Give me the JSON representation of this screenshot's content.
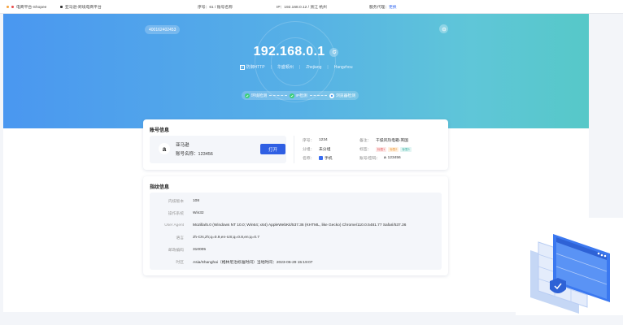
{
  "topbar": {
    "tab1": "电商平台-Shopee",
    "tab2": "亚马逊-跨境电商平台",
    "seq": "序号：61 / 账号名称",
    "ip": "IP：192.168.0.12 / 浙江 杭州",
    "proxy_label": "服务代理：",
    "proxy_link": "更换"
  },
  "hero": {
    "badge": "400162402453",
    "ip": "192.168.0.1",
    "protocol": "防御HTTP",
    "region": "华盛顿州",
    "province": "Zhejiang",
    "city": "Hangzhou",
    "steps": [
      "环境检测",
      "IP检测",
      "浏览器检测"
    ]
  },
  "account": {
    "title": "账号信息",
    "platform": "亚马逊",
    "account_label": "账号名称：",
    "account_value": "123456",
    "open_button": "打开",
    "seq_key": "序号：",
    "seq_value": "1234",
    "group_key": "分组：",
    "group_value": "未分组",
    "cat_key": "名称：",
    "cat_value": "手机",
    "remark_key": "备注：",
    "remark_value": "干燥风热电箱-英国",
    "tag_key": "标签：",
    "tags": [
      "标签1",
      "标签2",
      "标签3"
    ],
    "login_key": "账号/密码：",
    "login_value": "123456"
  },
  "fingerprint": {
    "title": "指纹信息",
    "rows": [
      {
        "k": "内核版本",
        "v": "108"
      },
      {
        "k": "操作系统",
        "v": "Win32"
      },
      {
        "k": "User Agent",
        "v": "Mozilla/5.0 (Windows NT 10.0; Win64; x64) AppleWebKit/537.36 (KHTML, like Gecko) Chrome/110.0.5481.77 Safari/537.36"
      },
      {
        "k": "语言",
        "v": "zh-CN,zh;q=0.9,en-US;q=0.8,en;q=0.7"
      },
      {
        "k": "邮政编码",
        "v": "310005"
      },
      {
        "k": "时区",
        "v": "Asia/Shanghai（格林尼治标准时间）当地时间：2023-06-29 15:19:07"
      }
    ]
  },
  "colors": {
    "accent": "#2f5fe3",
    "success": "#3ccf7b",
    "hero_start": "#4a97f0",
    "hero_end": "#56c8c8"
  }
}
